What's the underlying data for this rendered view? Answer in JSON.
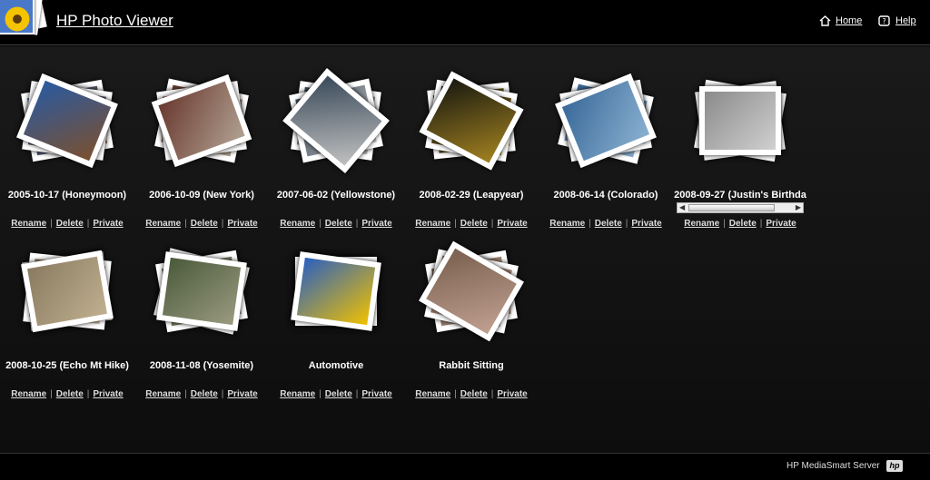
{
  "header": {
    "title": "HP Photo Viewer",
    "home_label": "Home",
    "help_label": "Help"
  },
  "albums": [
    {
      "title": "2005-10-17 (Honeymoon)",
      "colors": [
        "#2a5aa0",
        "#7a5030"
      ]
    },
    {
      "title": "2006-10-09 (New York)",
      "colors": [
        "#6a3a30",
        "#b0a090"
      ]
    },
    {
      "title": "2007-06-02 (Yellowstone)",
      "colors": [
        "#3a4a5a",
        "#c0c0c0"
      ]
    },
    {
      "title": "2008-02-29 (Leapyear)",
      "colors": [
        "#1a1a10",
        "#a08020"
      ]
    },
    {
      "title": "2008-06-14 (Colorado)",
      "colors": [
        "#3a6a9a",
        "#8ab0d0"
      ]
    },
    {
      "title": "2008-09-27 (Justin's Birthda",
      "colors": [
        "#8a8a8a",
        "#d0d0d0"
      ]
    },
    {
      "title": "2008-10-25 (Echo Mt Hike)",
      "colors": [
        "#8a7a60",
        "#c0b090"
      ]
    },
    {
      "title": "2008-11-08 (Yosemite)",
      "colors": [
        "#4a5a3a",
        "#9a9a80"
      ]
    },
    {
      "title": "Automotive",
      "colors": [
        "#2a60c0",
        "#f0c000"
      ]
    },
    {
      "title": "Rabbit Sitting",
      "colors": [
        "#7a6050",
        "#c0a090"
      ]
    }
  ],
  "actions": {
    "rename": "Rename",
    "delete": "Delete",
    "private": "Private",
    "separator": "|"
  },
  "footer": {
    "text": "HP MediaSmart Server",
    "logo": "hp"
  }
}
